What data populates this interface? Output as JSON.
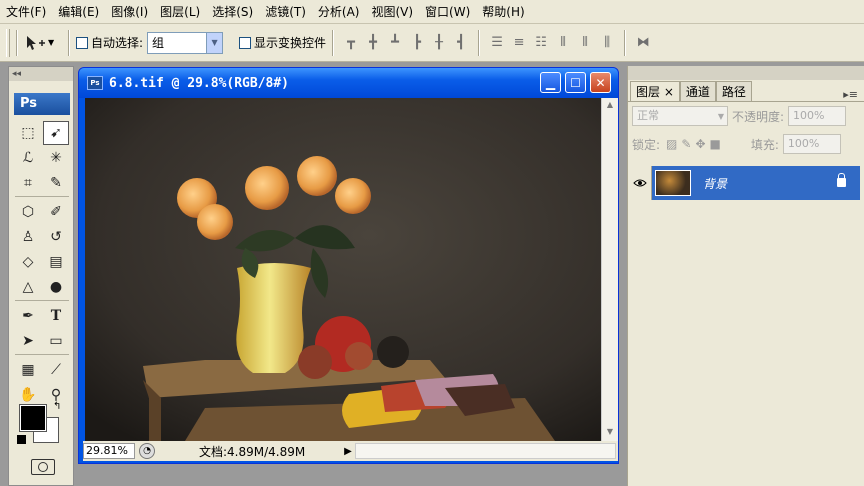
{
  "menubar": {
    "items": [
      "文件(F)",
      "编辑(E)",
      "图像(I)",
      "图层(L)",
      "选择(S)",
      "滤镜(T)",
      "分析(A)",
      "视图(V)",
      "窗口(W)",
      "帮助(H)"
    ]
  },
  "options": {
    "auto_select_label": "自动选择:",
    "auto_select_value": "组",
    "show_transform_label": "显示变换控件"
  },
  "toolbox": {
    "logo": "Ps"
  },
  "document": {
    "title": "6.8.tif @ 29.8%(RGB/8#)",
    "zoom": "29.81%",
    "doc_info": "文档:4.89M/4.89M"
  },
  "layers_panel": {
    "tabs": [
      "图层",
      "通道",
      "路径"
    ],
    "blend_mode": "正常",
    "opacity_label": "不透明度:",
    "opacity_value": "100%",
    "lock_label": "锁定:",
    "fill_label": "填充:",
    "fill_value": "100%",
    "layers": [
      {
        "name": "背景"
      }
    ]
  },
  "colors": {
    "titlebar_blue": "#0054e3",
    "selection_blue": "#316ac5",
    "panel_bg": "#ece9d8"
  }
}
